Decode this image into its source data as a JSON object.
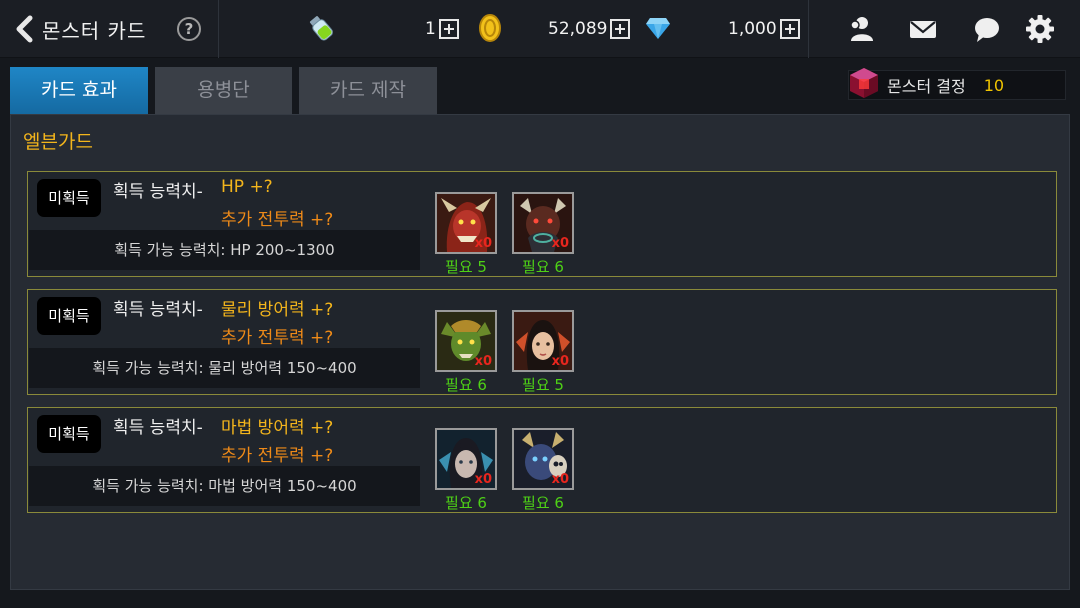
{
  "header": {
    "title": "몬스터 카드",
    "help_label": "?",
    "resources": {
      "stamina": "1",
      "gold": "52,089",
      "gems": "1,000"
    }
  },
  "tabs": [
    {
      "label": "카드 효과",
      "active": true
    },
    {
      "label": "용병단",
      "active": false
    },
    {
      "label": "카드 제작",
      "active": false
    }
  ],
  "crystal": {
    "label": "몬스터 결정",
    "count": "10"
  },
  "section": {
    "title": "엘븐가드"
  },
  "cards": [
    {
      "badge": "미획득",
      "stat_label": "획득 능력치-",
      "stat_value": "HP +?",
      "bonus": "추가 전투력 +?",
      "range": "획득 가능 능력치: HP 200~1300",
      "materials": [
        {
          "count": "x0",
          "need": "필요 5"
        },
        {
          "count": "x0",
          "need": "필요 6"
        }
      ]
    },
    {
      "badge": "미획득",
      "stat_label": "획득 능력치-",
      "stat_value": "물리 방어력 +?",
      "bonus": "추가 전투력 +?",
      "range": "획득 가능 능력치: 물리 방어력 150~400",
      "materials": [
        {
          "count": "x0",
          "need": "필요 6"
        },
        {
          "count": "x0",
          "need": "필요 5"
        }
      ]
    },
    {
      "badge": "미획득",
      "stat_label": "획득 능력치-",
      "stat_value": "마법 방어력 +?",
      "bonus": "추가 전투력 +?",
      "range": "획득 가능 능력치: 마법 방어력 150~400",
      "materials": [
        {
          "count": "x0",
          "need": "필요 6"
        },
        {
          "count": "x0",
          "need": "필요 6"
        }
      ]
    }
  ]
}
